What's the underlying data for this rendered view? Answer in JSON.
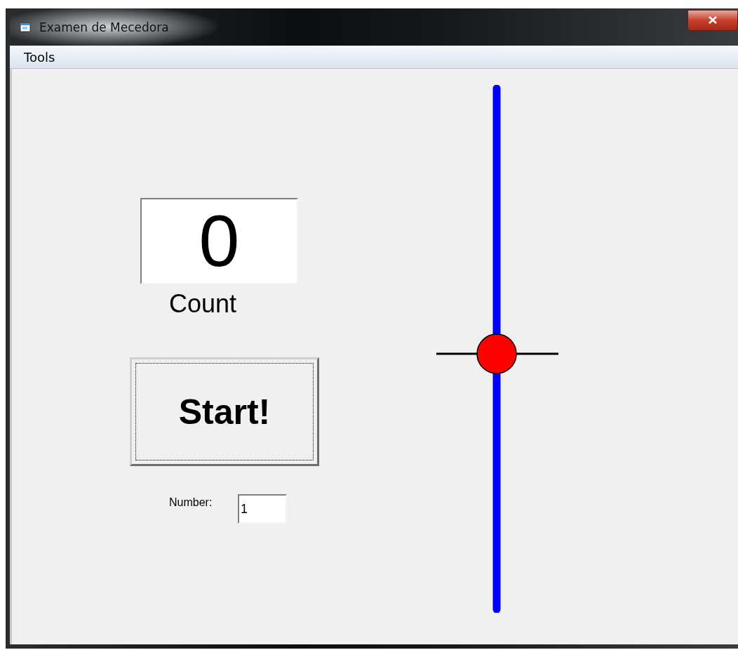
{
  "window": {
    "title": "Examen de Mecedora"
  },
  "menu": [
    "Tools"
  ],
  "counter": {
    "value": "0",
    "label": "Count"
  },
  "start_button": {
    "label": "Start!",
    "focused": true
  },
  "number_field": {
    "label": "Number:",
    "value": "1"
  }
}
